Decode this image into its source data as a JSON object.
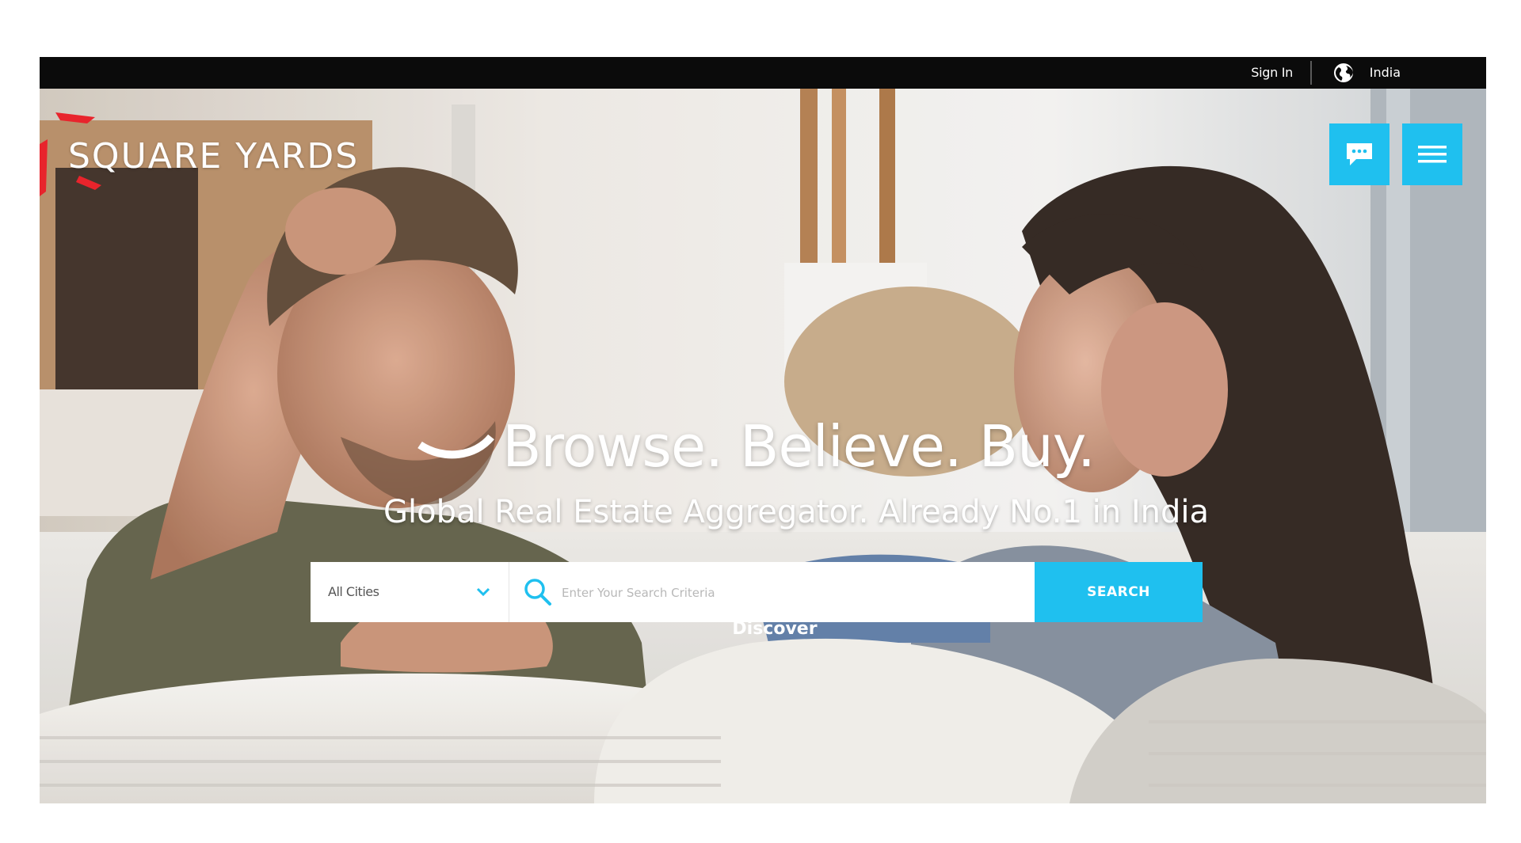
{
  "topbar": {
    "signin_label": "Sign In",
    "country_label": "India",
    "globe_icon": "globe-icon"
  },
  "brand": {
    "logo_text": "SQUARE YARDS",
    "accent_color": "#1fc0ef",
    "logo_accent_color": "#e8242c"
  },
  "header_buttons": {
    "chat_icon": "chat-icon",
    "menu_icon": "hamburger-menu-icon"
  },
  "hero": {
    "headline": "Browse. Believe. Buy.",
    "subheadline": "Global Real Estate Aggregator. Already No.1 in India",
    "discover_label": "Discover"
  },
  "search": {
    "city_selected": "All Cities",
    "placeholder": "Enter Your Search Criteria",
    "button_label": "SEARCH",
    "search_icon": "search-icon",
    "chevron_icon": "chevron-down-icon"
  }
}
